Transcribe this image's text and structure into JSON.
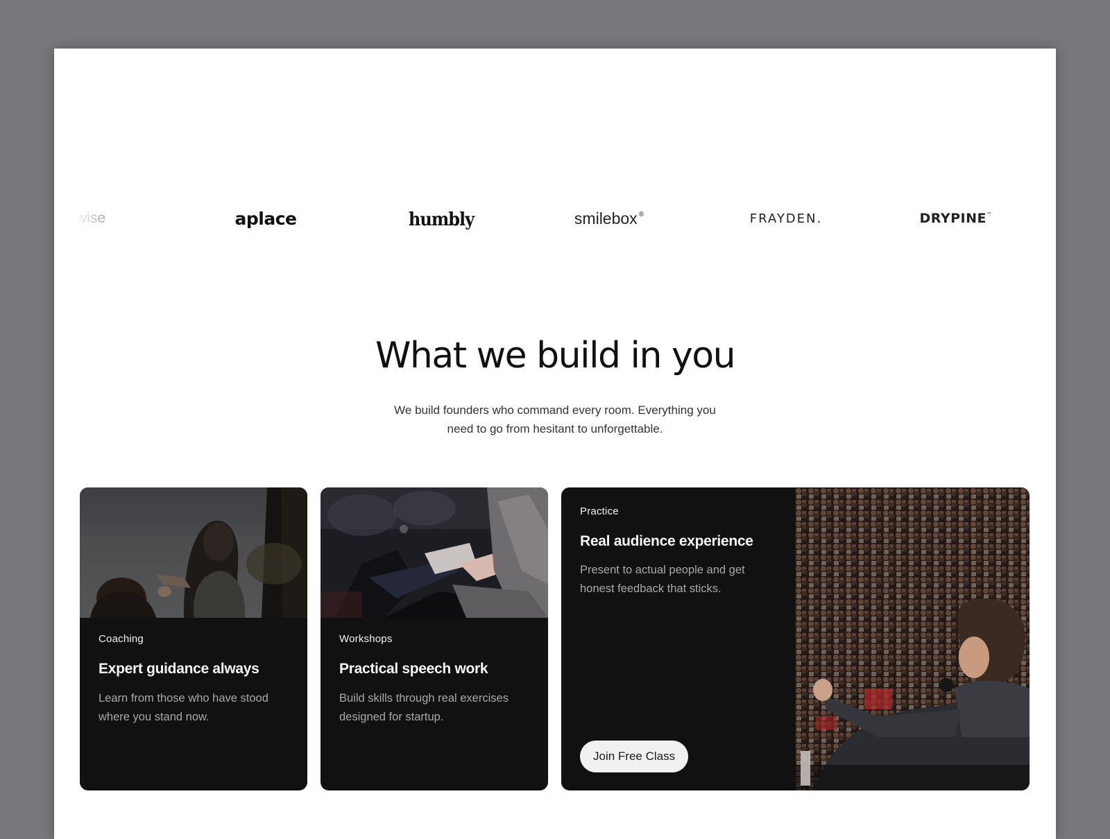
{
  "logos": [
    {
      "name": "wise",
      "text": "wise"
    },
    {
      "name": "aplace",
      "text": "aplace"
    },
    {
      "name": "humbly",
      "text": "humbly"
    },
    {
      "name": "smilebox",
      "text": "smilebox",
      "mark": "®"
    },
    {
      "name": "frayden",
      "text": "FRAYDEN."
    },
    {
      "name": "drypine",
      "text": "DRYPINE",
      "mark": "™"
    }
  ],
  "section": {
    "title": "What we build in you",
    "subtitle": "We build founders who command every room. Everything you need to go from hesitant to unforgettable."
  },
  "cards": [
    {
      "tag": "Coaching",
      "title": "Expert guidance always",
      "description": "Learn from those who have stood where you stand now.",
      "image": "mentor-conversation-photo"
    },
    {
      "tag": "Workshops",
      "title": "Practical speech work",
      "description": "Build skills through real exercises designed for startup.",
      "image": "workshop-notes-photo"
    },
    {
      "tag": "Practice",
      "title": "Real audience experience",
      "description": "Present to actual people and get honest feedback that sticks.",
      "button_label": "Join Free Class",
      "image": "speaker-audience-photo"
    }
  ],
  "colors": {
    "backdrop": "#77787c",
    "page": "#ffffff",
    "card": "#111111",
    "button": "#f1f1f1"
  }
}
